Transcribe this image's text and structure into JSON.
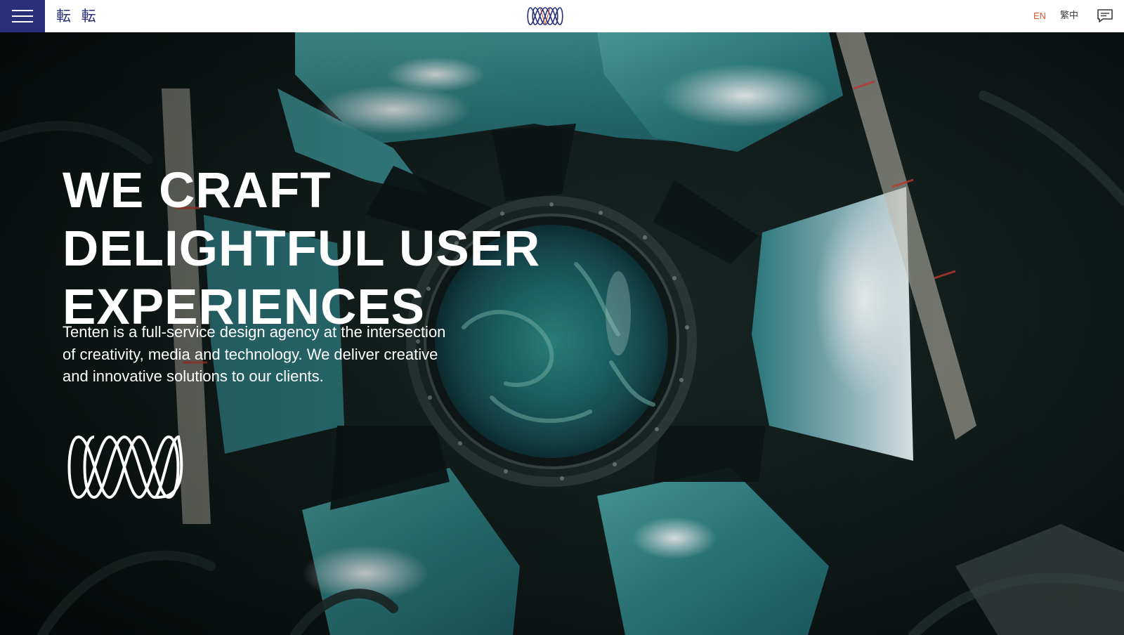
{
  "header": {
    "brand_name": "転 転",
    "languages": {
      "en": "EN",
      "zh": "繁中"
    },
    "icons": {
      "menu": "hamburger-menu-icon",
      "logo": "tenten-wave-logo-icon",
      "contact": "chat-bubble-icon"
    }
  },
  "hero": {
    "headline": [
      "WE CRAFT",
      "DELIGHTFUL USER",
      "EXPERIENCES"
    ],
    "description": "Tenten is a full-service design agency at the intersection of creativity, media and technology. We deliver creative and innovative solutions to our clients.",
    "logo_icon": "tenten-wave-logo-icon"
  },
  "colors": {
    "brand_navy": "#2a2f7c",
    "active_language": "#e0582e",
    "header_background": "#ffffff",
    "hero_text": "#ffffff"
  }
}
